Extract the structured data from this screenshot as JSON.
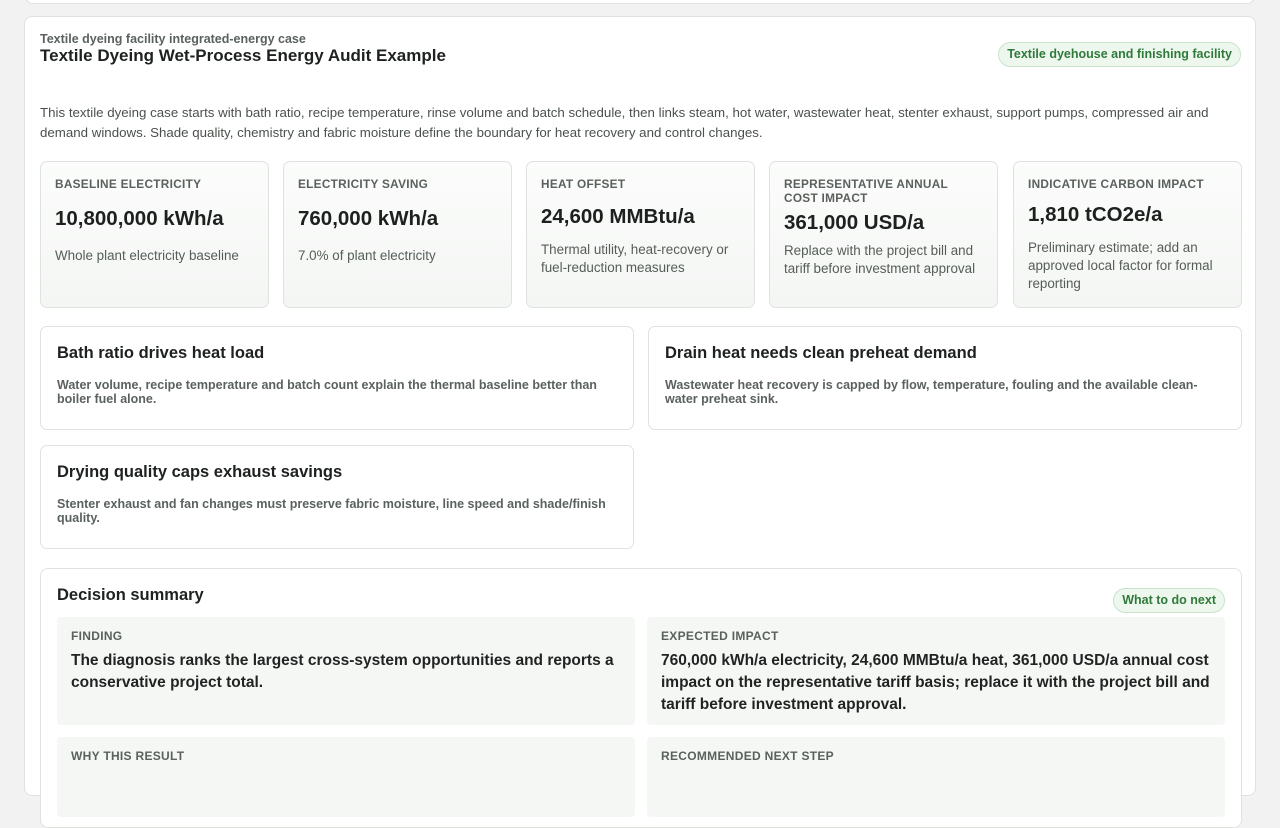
{
  "header": {
    "eyebrow": "Textile dyeing facility integrated-energy case",
    "title": "Textile Dyeing Wet-Process Energy Audit Example",
    "facility_badge": "Textile dyehouse and finishing facility"
  },
  "intro": "This textile dyeing case starts with bath ratio, recipe temperature, rinse volume and batch schedule, then links steam, hot water, wastewater heat, stenter exhaust, support pumps, compressed air and demand windows. Shade quality, chemistry and fabric moisture define the boundary for heat recovery and control changes.",
  "metrics": [
    {
      "label": "Baseline electricity",
      "value": "10,800,000 kWh/a",
      "note": "Whole plant electricity baseline"
    },
    {
      "label": "Electricity saving",
      "value": "760,000 kWh/a",
      "note": "7.0% of plant electricity"
    },
    {
      "label": "Heat offset",
      "value": "24,600 MMBtu/a",
      "note": "Thermal utility, heat-recovery or fuel-reduction measures"
    },
    {
      "label": "Representative annual cost impact",
      "value": "361,000 USD/a",
      "note": "Replace with the project bill and tariff before investment approval"
    },
    {
      "label": "Indicative carbon impact",
      "value": "1,810 tCO2e/a",
      "note": "Preliminary estimate; add an approved local factor for formal reporting"
    }
  ],
  "insights": [
    {
      "title": "Bath ratio drives heat load",
      "body": "Water volume, recipe temperature and batch count explain the thermal baseline better than boiler fuel alone."
    },
    {
      "title": "Drain heat needs clean preheat demand",
      "body": "Wastewater heat recovery is capped by flow, temperature, fouling and the available clean-water preheat sink."
    },
    {
      "title": "Drying quality caps exhaust savings",
      "body": "Stenter exhaust and fan changes must preserve fabric moisture, line speed and shade/finish quality."
    }
  ],
  "decision": {
    "title": "Decision summary",
    "badge": "What to do next",
    "finding_label": "Finding",
    "finding_text": "The diagnosis ranks the largest cross-system opportunities and reports a conservative project total.",
    "impact_label": "Expected impact",
    "impact_text": "760,000 kWh/a electricity, 24,600 MMBtu/a heat, 361,000 USD/a annual cost impact on the representative tariff basis; replace it with the project bill and tariff before investment approval.",
    "why_label": "Why this result",
    "next_label": "Recommended next step"
  }
}
